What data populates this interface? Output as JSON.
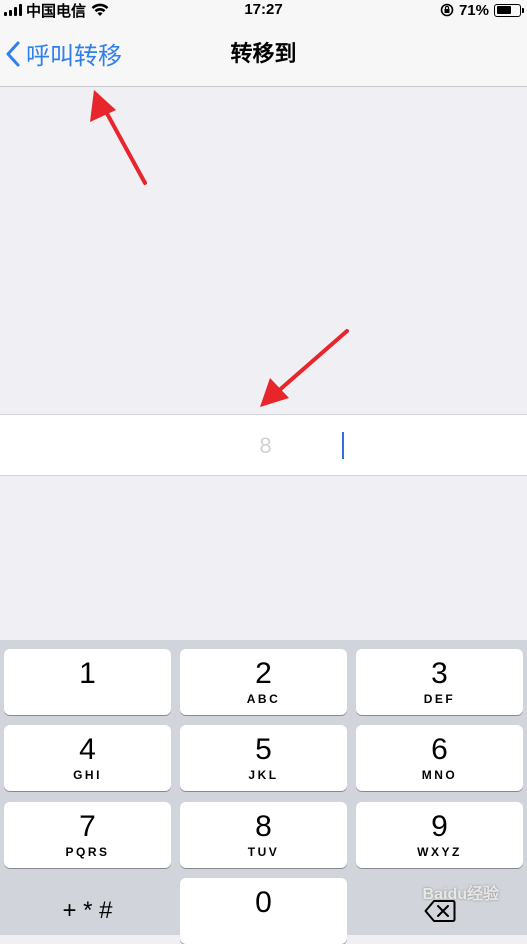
{
  "status_bar": {
    "carrier": "中国电信",
    "time": "17:27",
    "battery_percent": "71%",
    "battery_level": 0.71
  },
  "nav": {
    "back_label": "呼叫转移",
    "title": "转移到"
  },
  "input": {
    "value": "8"
  },
  "keypad": {
    "keys": [
      {
        "num": "1",
        "letters": ""
      },
      {
        "num": "2",
        "letters": "ABC"
      },
      {
        "num": "3",
        "letters": "DEF"
      },
      {
        "num": "4",
        "letters": "GHI"
      },
      {
        "num": "5",
        "letters": "JKL"
      },
      {
        "num": "6",
        "letters": "MNO"
      },
      {
        "num": "7",
        "letters": "PQRS"
      },
      {
        "num": "8",
        "letters": "TUV"
      },
      {
        "num": "9",
        "letters": "WXYZ"
      },
      {
        "num": "0",
        "letters": ""
      }
    ],
    "symbols_label": "+ * #"
  },
  "watermark": "Baidu经验",
  "colors": {
    "accent": "#2f80ed",
    "arrow": "#e8252a"
  }
}
